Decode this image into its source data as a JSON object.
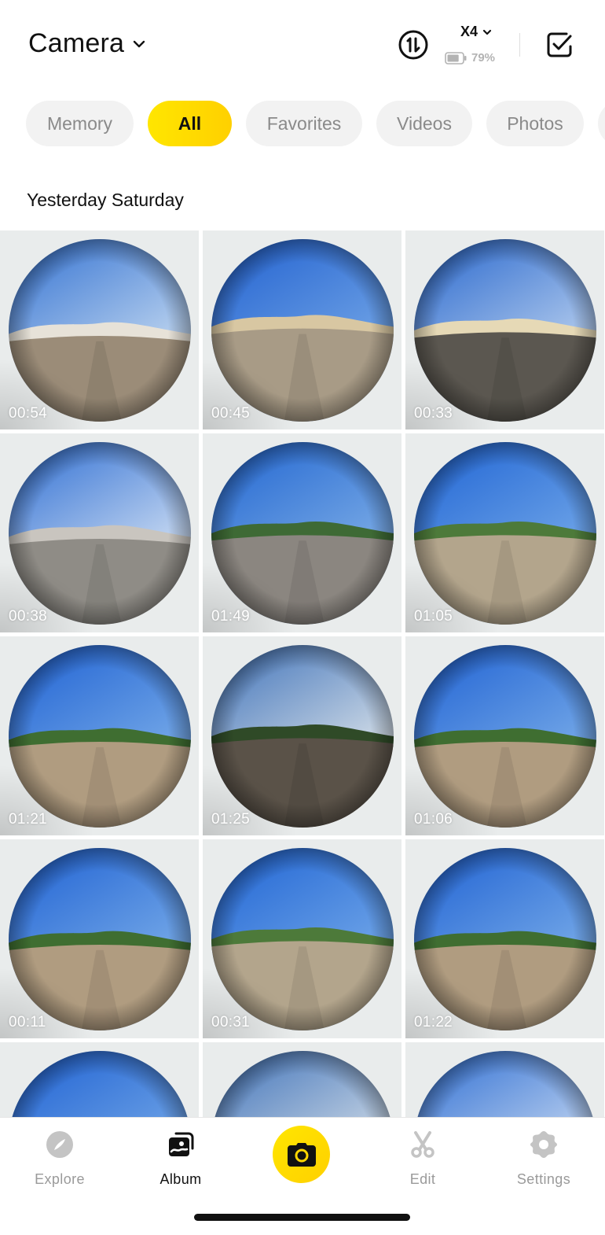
{
  "header": {
    "title": "Camera",
    "title_icon": "chevron-down-icon",
    "sync_icon": "transfer-sync-icon",
    "camera_model": "X4",
    "battery_percent": "79%",
    "battery_level": 0.79,
    "select_icon": "checkbox-select-icon"
  },
  "filters": {
    "chips": [
      {
        "label": "Memory",
        "active": false
      },
      {
        "label": "All",
        "active": true
      },
      {
        "label": "Favorites",
        "active": false
      },
      {
        "label": "Videos",
        "active": false
      },
      {
        "label": "Photos",
        "active": false
      },
      {
        "label": "",
        "active": false
      }
    ]
  },
  "section": {
    "title": "Yesterday Saturday"
  },
  "media": [
    {
      "duration": "00:54",
      "scene": "street"
    },
    {
      "duration": "00:45",
      "scene": "promenade"
    },
    {
      "duration": "00:33",
      "scene": "balustrade"
    },
    {
      "duration": "00:38",
      "scene": "harbor"
    },
    {
      "duration": "01:49",
      "scene": "marina-walk"
    },
    {
      "duration": "01:05",
      "scene": "path"
    },
    {
      "duration": "01:21",
      "scene": "field"
    },
    {
      "duration": "01:25",
      "scene": "tree-sun"
    },
    {
      "duration": "01:06",
      "scene": "field"
    },
    {
      "duration": "00:11",
      "scene": "field"
    },
    {
      "duration": "00:31",
      "scene": "path"
    },
    {
      "duration": "01:22",
      "scene": "field"
    },
    {
      "duration": "",
      "scene": "field"
    },
    {
      "duration": "",
      "scene": "tree-sun"
    },
    {
      "duration": "",
      "scene": "harbor"
    }
  ],
  "colors": {
    "accent": "#FFD700",
    "tile_bg": "#E9ECEC",
    "chip_bg": "#F2F2F2",
    "inactive_text": "#9A9A9A"
  },
  "bottom_nav": {
    "items": [
      {
        "label": "Explore",
        "icon": "compass-icon",
        "active": false
      },
      {
        "label": "Album",
        "icon": "album-icon",
        "active": true
      },
      {
        "label": "",
        "icon": "camera-icon",
        "active": false
      },
      {
        "label": "Edit",
        "icon": "scissors-icon",
        "active": false
      },
      {
        "label": "Settings",
        "icon": "gear-icon",
        "active": false
      }
    ]
  }
}
